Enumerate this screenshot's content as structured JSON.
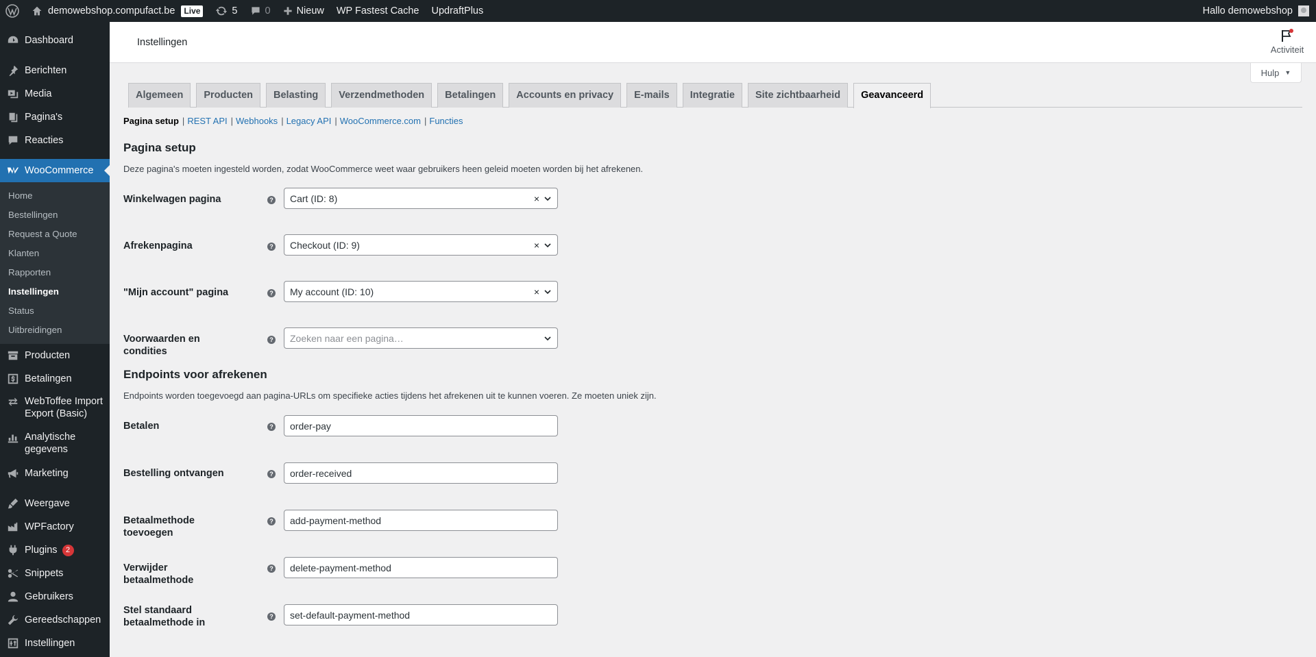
{
  "adminbar": {
    "site_name": "demowebshop.compufact.be",
    "live_badge": "Live",
    "updates_count": "5",
    "comments_count": "0",
    "new_label": "Nieuw",
    "plugin1": "WP Fastest Cache",
    "plugin2": "UpdraftPlus",
    "greeting": "Hallo demowebshop"
  },
  "sidebar": {
    "items_top": [
      {
        "label": "Dashboard",
        "icon": "dashboard-icon"
      },
      {
        "label": "Berichten",
        "icon": "pin-icon"
      },
      {
        "label": "Media",
        "icon": "media-icon"
      },
      {
        "label": "Pagina's",
        "icon": "page-icon"
      },
      {
        "label": "Reacties",
        "icon": "comment-icon"
      }
    ],
    "woocommerce": "WooCommerce",
    "woo_submenu": [
      "Home",
      "Bestellingen",
      "Request a Quote",
      "Klanten",
      "Rapporten",
      "Instellingen",
      "Status",
      "Uitbreidingen"
    ],
    "items_bottom": [
      {
        "label": "Producten",
        "icon": "archive-icon"
      },
      {
        "label": "Betalingen",
        "icon": "dollar-icon"
      },
      {
        "label": "WebToffee Import Export (Basic)",
        "icon": "import-export-icon"
      },
      {
        "label": "Analytische gegevens",
        "icon": "chart-icon"
      },
      {
        "label": "Marketing",
        "icon": "megaphone-icon"
      },
      {
        "label": "Weergave",
        "icon": "brush-icon"
      },
      {
        "label": "WPFactory",
        "icon": "factory-icon"
      },
      {
        "label": "Plugins",
        "icon": "plugin-icon",
        "badge": "2"
      },
      {
        "label": "Snippets",
        "icon": "snippets-icon"
      },
      {
        "label": "Gebruikers",
        "icon": "users-icon"
      },
      {
        "label": "Gereedschappen",
        "icon": "wrench-icon"
      },
      {
        "label": "Instellingen",
        "icon": "settings-icon"
      }
    ]
  },
  "header": {
    "title": "Instellingen",
    "activity": "Activiteit",
    "help": "Hulp"
  },
  "tabs": [
    "Algemeen",
    "Producten",
    "Belasting",
    "Verzendmethoden",
    "Betalingen",
    "Accounts en privacy",
    "E-mails",
    "Integratie",
    "Site zichtbaarheid",
    "Geavanceerd"
  ],
  "active_tab": "Geavanceerd",
  "subnav": [
    "Pagina setup",
    "REST API",
    "Webhooks",
    "Legacy API",
    "WooCommerce.com",
    "Functies"
  ],
  "page_setup": {
    "heading": "Pagina setup",
    "description": "Deze pagina's moeten ingesteld worden, zodat WooCommerce weet waar gebruikers heen geleid moeten worden bij het afrekenen.",
    "fields": [
      {
        "label": "Winkelwagen pagina",
        "value": "Cart (ID: 8)",
        "placeholder": ""
      },
      {
        "label": "Afrekenpagina",
        "value": "Checkout (ID: 9)",
        "placeholder": ""
      },
      {
        "label": "\"Mijn account\" pagina",
        "value": "My account (ID: 10)",
        "placeholder": ""
      },
      {
        "label": "Voorwaarden en condities",
        "value": "",
        "placeholder": "Zoeken naar een pagina…"
      }
    ]
  },
  "endpoints": {
    "heading": "Endpoints voor afrekenen",
    "description": "Endpoints worden toegevoegd aan pagina-URLs om specifieke acties tijdens het afrekenen uit te kunnen voeren. Ze moeten uniek zijn.",
    "fields": [
      {
        "label": "Betalen",
        "value": "order-pay"
      },
      {
        "label": "Bestelling ontvangen",
        "value": "order-received"
      },
      {
        "label": "Betaalmethode toevoegen",
        "value": "add-payment-method"
      },
      {
        "label": "Verwijder betaalmethode",
        "value": "delete-payment-method"
      },
      {
        "label": "Stel standaard betaalmethode in",
        "value": "set-default-payment-method"
      }
    ]
  },
  "colors": {
    "accent": "#2271b1",
    "admin_dark": "#1d2327",
    "badge_red": "#d63638"
  }
}
